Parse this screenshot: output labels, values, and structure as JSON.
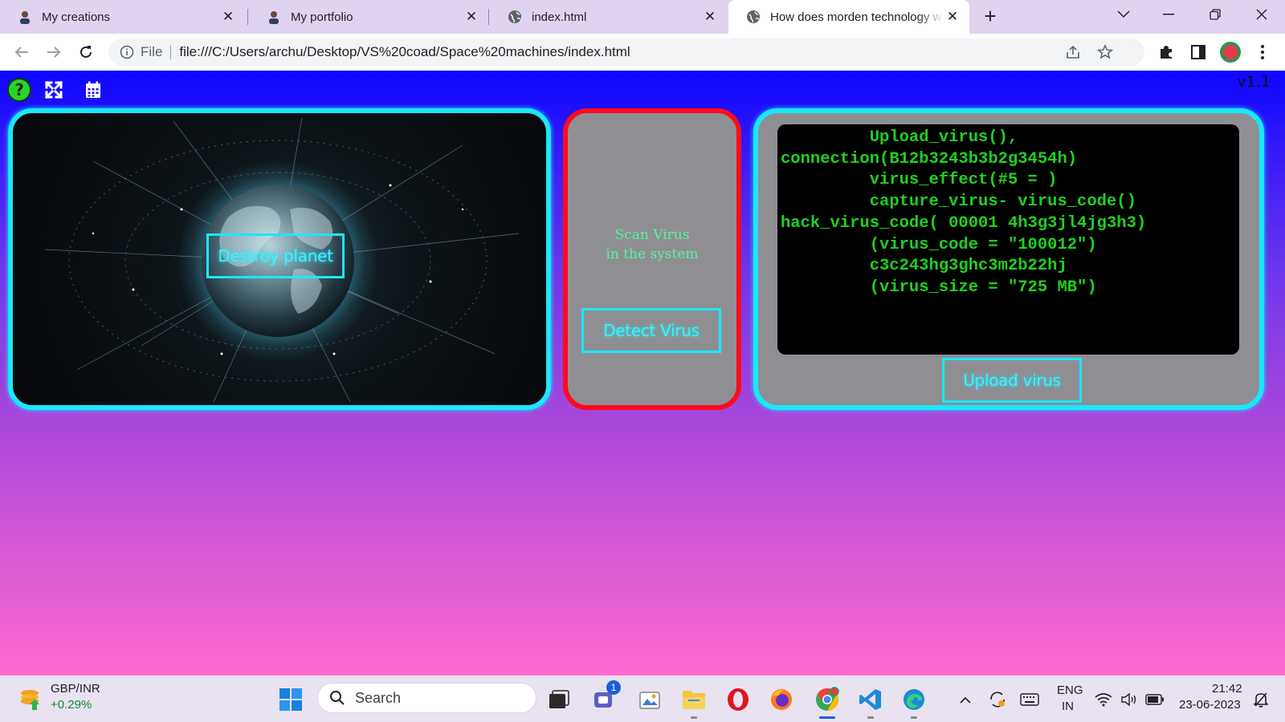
{
  "browser": {
    "tabs": [
      {
        "title": "My creations",
        "icon": "avatar-icon"
      },
      {
        "title": "My portfolio",
        "icon": "avatar-icon"
      },
      {
        "title": "index.html",
        "icon": "globe-icon"
      },
      {
        "title": "How does morden technology w",
        "icon": "globe-icon",
        "active": true
      }
    ],
    "address": {
      "scheme": "File",
      "url": "file:///C:/Users/archu/Desktop/VS%20coad/Space%20machines/index.html"
    }
  },
  "page": {
    "version": "v1.1",
    "planet_button": "Destroy planet",
    "scan_text_line1": "Scan Virus",
    "scan_text_line2": "in the system",
    "detect_button": "Detect Virus",
    "terminal_lines": [
      "         Upload_virus(),",
      "connection(B12b3243b3b2g3454h)",
      "         virus_effect(#5 = )",
      "         capture_virus- virus_code()",
      "hack_virus_code( 00001 4h3g3jl4jg3h3)",
      "         (virus_code = \"100012\")",
      "         c3c243hg3ghc3m2b22hj",
      "         (virus_size = \"725 MB\")"
    ],
    "upload_button": "Upload virus",
    "colors": {
      "panel_border": "#19e8ff",
      "scan_border": "#ff0a1e",
      "terminal_text": "#1fd11f"
    }
  },
  "taskbar": {
    "ticker_name": "GBP/INR",
    "ticker_change": "+0.29%",
    "search_placeholder": "Search",
    "chat_badge": "1",
    "lang_line1": "ENG",
    "lang_line2": "IN",
    "time": "21:42",
    "date": "23-06-2023"
  }
}
